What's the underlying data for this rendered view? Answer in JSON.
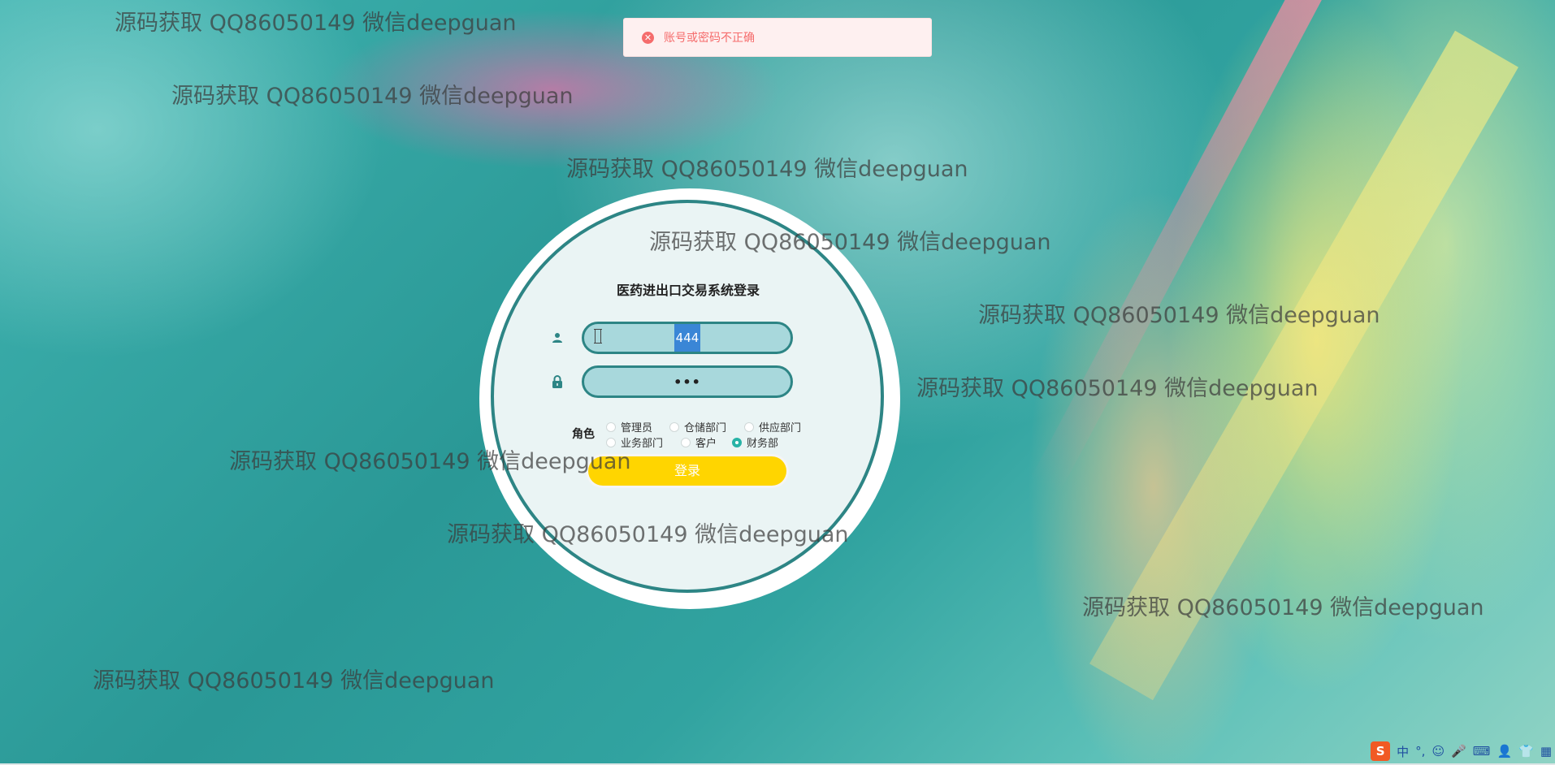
{
  "toast": {
    "icon": "error-circle-icon",
    "message": "账号或密码不正确",
    "color": "#f56c6c"
  },
  "login": {
    "title": "医药进出口交易系统登录",
    "username_value": "444",
    "password_value": "•••",
    "role_label": "角色",
    "roles": [
      {
        "label": "管理员",
        "checked": false
      },
      {
        "label": "仓储部门",
        "checked": false
      },
      {
        "label": "供应部门",
        "checked": false
      },
      {
        "label": "业务部门",
        "checked": false
      },
      {
        "label": "客户",
        "checked": false
      },
      {
        "label": "财务部",
        "checked": true
      }
    ],
    "submit_label": "登录",
    "button_color": "#ffd500",
    "accent_color": "#2d8585"
  },
  "watermark": {
    "text": "源码获取 QQ86050149 微信deepguan"
  },
  "tray": {
    "items": [
      "S",
      "中",
      "°,",
      "☺",
      "🎤",
      "⌨",
      "👤",
      "👕",
      "▦"
    ]
  }
}
